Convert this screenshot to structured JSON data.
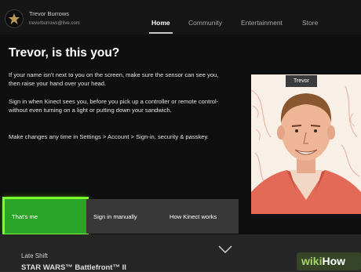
{
  "profile": {
    "name": "Trevor Burrows",
    "email": "trevorburrows@live.com"
  },
  "nav": [
    {
      "label": "Home",
      "active": true
    },
    {
      "label": "Community"
    },
    {
      "label": "Entertainment"
    },
    {
      "label": "Store"
    }
  ],
  "dialog": {
    "title": "Trevor, is this you?",
    "para1": "If your name isn't next to you on the screen, make sure the sensor can see you, then raise your hand over your head.",
    "para2": "Sign in when Kinect sees you, before you pick up a controller or remote control-without even turning on a light or putting down your sandwich.",
    "para3": "Make changes any time in Settings > Account > Sign-in, security & passkey.",
    "name_tag": "Trevor",
    "buttons": [
      "That's me",
      "Sign in manually",
      "How Kinect works"
    ]
  },
  "below": {
    "item1": "Late Shift",
    "item2": "STAR WARS™ Battlefront™ II"
  },
  "watermark": {
    "prefix": "wiki",
    "suffix": "How"
  },
  "colors": {
    "selected_button": "#2aa52a",
    "selection_glow": "#7cff2b",
    "background": "#0f0f0f"
  }
}
